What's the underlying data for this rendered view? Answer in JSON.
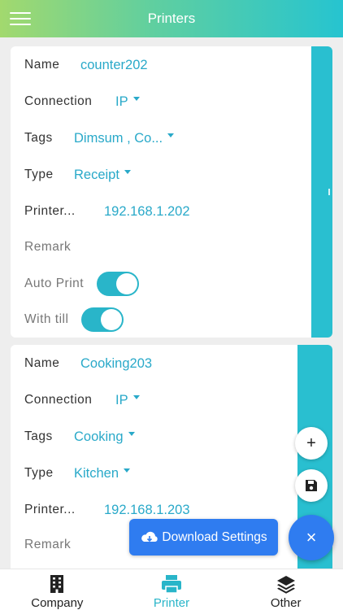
{
  "header": {
    "title": "Printers"
  },
  "printers": [
    {
      "name_label": "Name",
      "name": "counter202",
      "connection_label": "Connection",
      "connection": "IP",
      "tags_label": "Tags",
      "tags": "Dimsum , Co...",
      "type_label": "Type",
      "type": "Receipt",
      "printer_label": "Printer...",
      "printer": "192.168.1.202",
      "remark_label": "Remark",
      "auto_print_label": "Auto Print",
      "with_till_label": "With till"
    },
    {
      "name_label": "Name",
      "name": "Cooking203",
      "connection_label": "Connection",
      "connection": "IP",
      "tags_label": "Tags",
      "tags": "Cooking",
      "type_label": "Type",
      "type": "Kitchen",
      "printer_label": "Printer...",
      "printer": "192.168.1.203",
      "remark_label": "Remark"
    }
  ],
  "actions": {
    "add_symbol": "+",
    "close_symbol": "×",
    "download_label": "Download Settings"
  },
  "tabs": [
    {
      "label": "Company",
      "icon": "building-icon"
    },
    {
      "label": "Printer",
      "icon": "printer-icon"
    },
    {
      "label": "Other",
      "icon": "layers-icon"
    }
  ],
  "colors": {
    "accent": "#29b5c9",
    "primary_button": "#2f7cf0",
    "strip": "#29bfd0"
  }
}
